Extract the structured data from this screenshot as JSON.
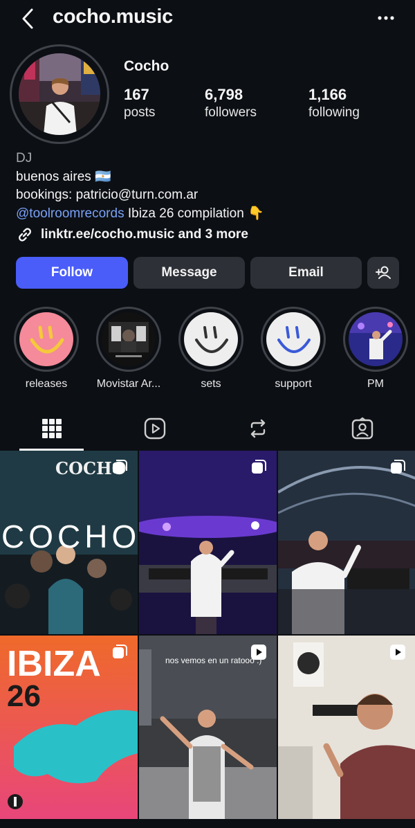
{
  "header": {
    "username": "cocho.music"
  },
  "profile": {
    "display_name": "Cocho",
    "stats": [
      {
        "value": "167",
        "label": "posts"
      },
      {
        "value": "6,798",
        "label": "followers"
      },
      {
        "value": "1,166",
        "label": "following"
      }
    ],
    "bio": {
      "category": "DJ",
      "line1": "buenos aires 🇦🇷",
      "line2": "bookings: patricio@turn.com.ar",
      "mention": "@toolroomrecords",
      "line3_rest": " Ibiza 26 compilation 👇",
      "link": "linktr.ee/cocho.music and 3 more"
    }
  },
  "actions": {
    "follow": "Follow",
    "message": "Message",
    "email": "Email"
  },
  "highlights": [
    {
      "label": "releases"
    },
    {
      "label": "Movistar Ar..."
    },
    {
      "label": "sets"
    },
    {
      "label": "support"
    },
    {
      "label": "PM"
    }
  ],
  "posts": [
    {
      "overlay_text": "COCHO",
      "overlay_text_2": "COCHO"
    },
    {
      "overlay_text": ""
    },
    {
      "overlay_text": ""
    },
    {
      "overlay_text": "IBIZA",
      "overlay_text_2": "26"
    },
    {
      "overlay_text": "nos vemos en un ratooo :)"
    },
    {
      "overlay_text": ""
    }
  ],
  "colors": {
    "accent": "#4a5df9",
    "background": "#0c0f14",
    "mention": "#7aa2f7"
  }
}
